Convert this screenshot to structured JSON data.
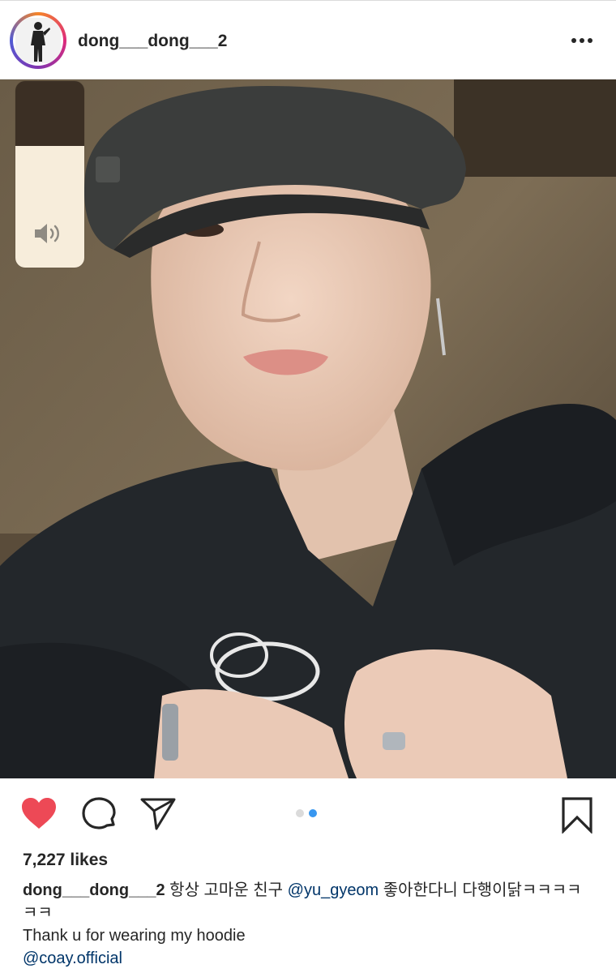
{
  "post": {
    "username": "dong___dong___2",
    "more_icon": "more-horizontal-icon",
    "likes": "7,227 likes",
    "carousel": {
      "count": 2,
      "active_index": 1
    },
    "volume_level": 0.65
  },
  "caption": {
    "username": "dong___dong___2",
    "text1": " 항상 고마운 친구 ",
    "mention1": "@yu_gyeom",
    "text2": " 좋아한다니 다행이닭ㅋㅋㅋㅋㅋㅋ",
    "line2": "Thank u for wearing my hoodie",
    "mention2": "@coay.official"
  },
  "actions": {
    "like_icon": "heart-filled-icon",
    "comment_icon": "comment-icon",
    "share_icon": "send-icon",
    "save_icon": "bookmark-icon"
  },
  "colors": {
    "like": "#ed4956",
    "active_dot": "#3897f0",
    "inactive_dot": "#dbdbdb",
    "mention": "#003569"
  }
}
